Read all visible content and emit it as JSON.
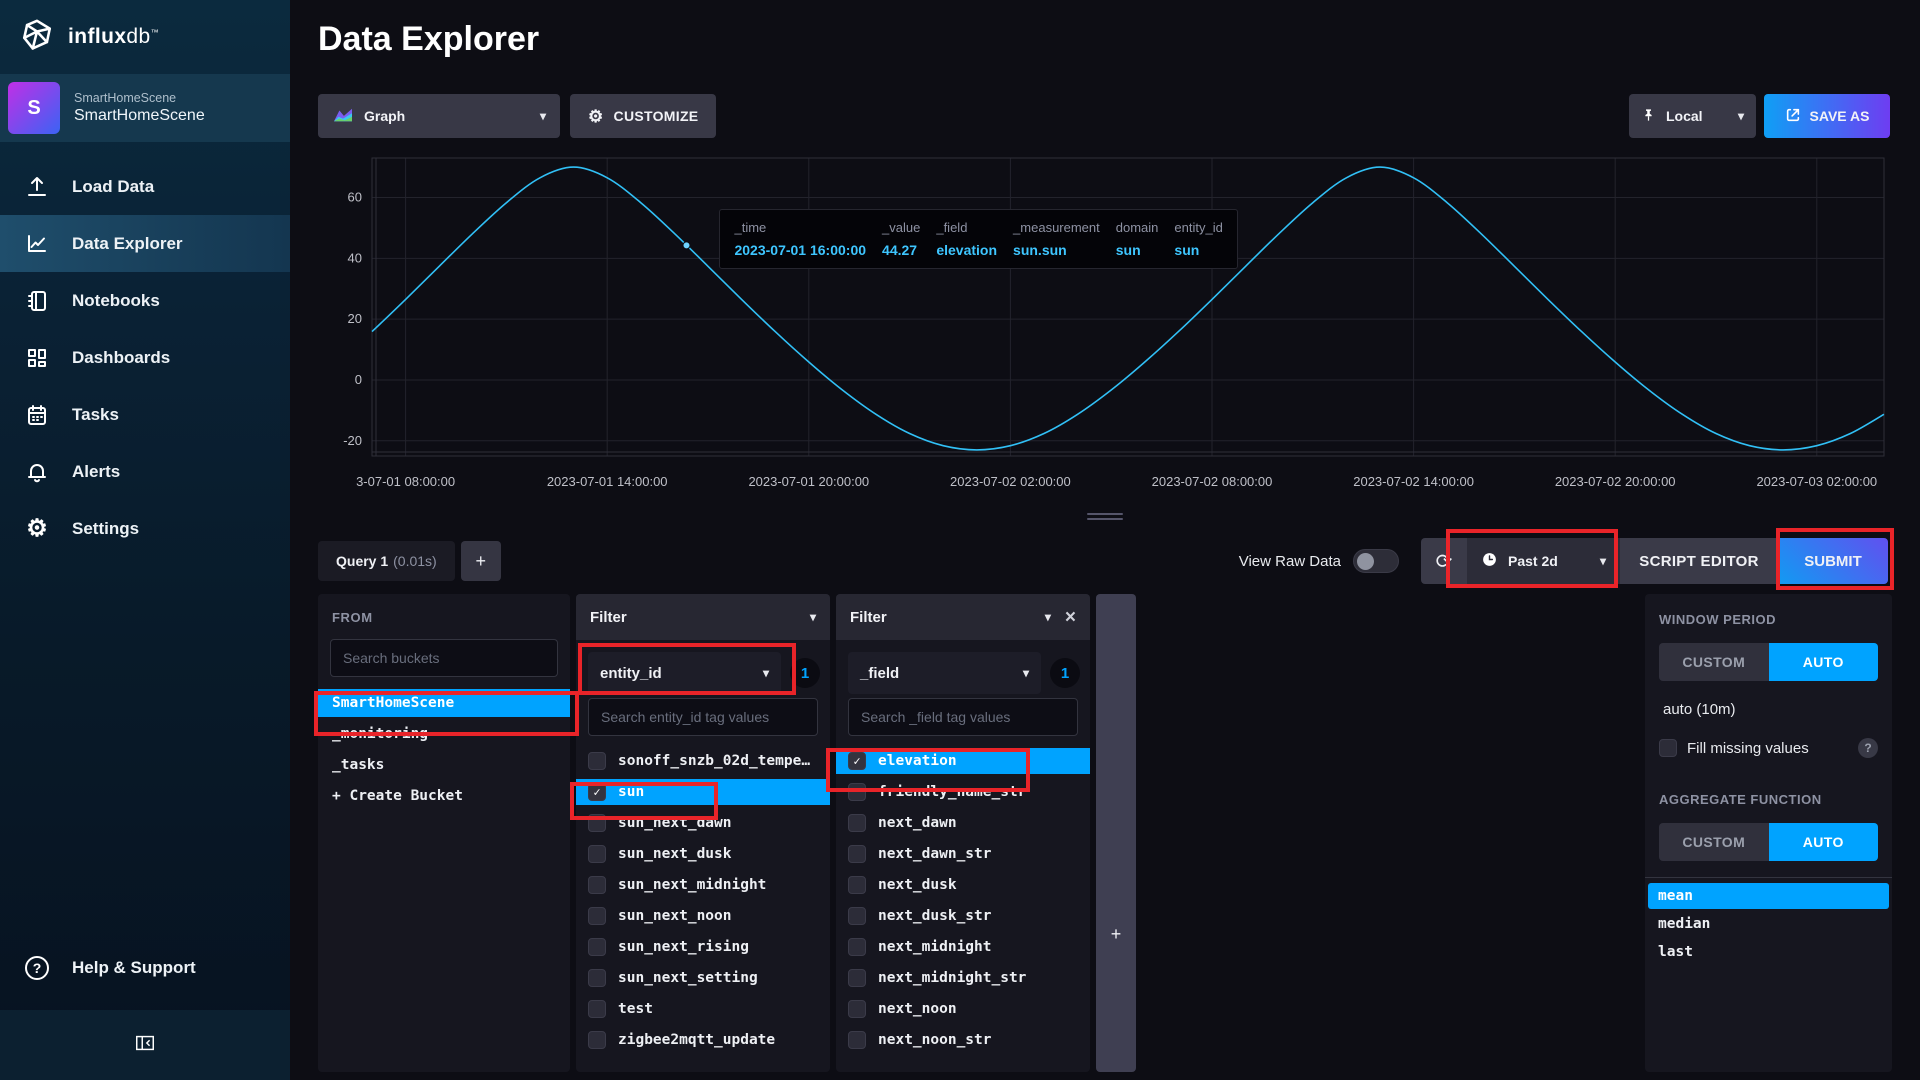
{
  "colors": {
    "accent": "#00a3ff",
    "line": "#31c0f6",
    "annotation": "#e92429",
    "save_gradient": [
      "#0f9ff5",
      "#6e3df2"
    ]
  },
  "sidebar": {
    "logo_bold": "influx",
    "logo_light": "db",
    "logo_tm": "™",
    "org": {
      "avatar_letter": "S",
      "line1": "SmartHomeScene",
      "line2": "SmartHomeScene"
    },
    "nav": [
      {
        "icon": "upload-icon",
        "label": "Load Data"
      },
      {
        "icon": "line-chart-icon",
        "label": "Data Explorer",
        "active": true
      },
      {
        "icon": "notebook-icon",
        "label": "Notebooks"
      },
      {
        "icon": "grid-icon",
        "label": "Dashboards"
      },
      {
        "icon": "calendar-icon",
        "label": "Tasks"
      },
      {
        "icon": "bell-icon",
        "label": "Alerts"
      },
      {
        "icon": "gear-icon",
        "label": "Settings"
      }
    ],
    "help_label": "Help & Support"
  },
  "header": {
    "title": "Data Explorer",
    "graph_dropdown_label": "Graph",
    "customize_label": "CUSTOMIZE",
    "local_label": "Local",
    "save_as_label": "SAVE AS"
  },
  "chart_data": {
    "type": "line",
    "series_name": "elevation (sun.sun)",
    "x_unit": "hours since 2023-07-01 00:00",
    "xlim": [
      7,
      52
    ],
    "ylim": [
      -25,
      73
    ],
    "y_ticks": [
      60,
      40,
      20,
      0,
      -20
    ],
    "x_ticks": [
      {
        "t": 8,
        "label": "3-07-01 08:00:00"
      },
      {
        "t": 14,
        "label": "2023-07-01 14:00:00"
      },
      {
        "t": 20,
        "label": "2023-07-01 20:00:00"
      },
      {
        "t": 26,
        "label": "2023-07-02 02:00:00"
      },
      {
        "t": 32,
        "label": "2023-07-02 08:00:00"
      },
      {
        "t": 38,
        "label": "2023-07-02 14:00:00"
      },
      {
        "t": 44,
        "label": "2023-07-02 20:00:00"
      },
      {
        "t": 50,
        "label": "2023-07-03 02:00:00"
      }
    ],
    "samples": [
      [
        7,
        15.9
      ],
      [
        8,
        26.5
      ],
      [
        9,
        37.4
      ],
      [
        10,
        48.2
      ],
      [
        11,
        58.3
      ],
      [
        12,
        66.5
      ],
      [
        13,
        70.0
      ],
      [
        14,
        66.5
      ],
      [
        15,
        58.3
      ],
      [
        16,
        48.2
      ],
      [
        17,
        37.4
      ],
      [
        18,
        26.5
      ],
      [
        19,
        15.9
      ],
      [
        20,
        5.9
      ],
      [
        21,
        -3.3
      ],
      [
        22,
        -11.3
      ],
      [
        23,
        -17.6
      ],
      [
        24,
        -21.6
      ],
      [
        25,
        -23.0
      ],
      [
        26,
        -21.6
      ],
      [
        27,
        -17.6
      ],
      [
        28,
        -11.3
      ],
      [
        29,
        -3.3
      ],
      [
        30,
        5.9
      ],
      [
        31,
        15.9
      ],
      [
        32,
        26.5
      ],
      [
        33,
        37.4
      ],
      [
        34,
        48.2
      ],
      [
        35,
        58.3
      ],
      [
        36,
        66.5
      ],
      [
        37,
        70.0
      ],
      [
        38,
        66.5
      ],
      [
        39,
        58.3
      ],
      [
        40,
        48.2
      ],
      [
        41,
        37.4
      ],
      [
        42,
        26.5
      ],
      [
        43,
        15.9
      ],
      [
        44,
        5.9
      ],
      [
        45,
        -3.3
      ],
      [
        46,
        -11.3
      ],
      [
        47,
        -17.6
      ],
      [
        48,
        -21.6
      ],
      [
        49,
        -23.0
      ],
      [
        50,
        -21.6
      ],
      [
        51,
        -17.6
      ],
      [
        52,
        -11.3
      ]
    ],
    "marker": {
      "t": 16.36,
      "value": 44.27
    },
    "grid": true,
    "legend": false
  },
  "tooltip": {
    "columns": [
      {
        "label": "_time",
        "value": "2023-07-01 16:00:00"
      },
      {
        "label": "_value",
        "value": "44.27"
      },
      {
        "label": "_field",
        "value": "elevation"
      },
      {
        "label": "_measurement",
        "value": "sun.sun"
      },
      {
        "label": "domain",
        "value": "sun"
      },
      {
        "label": "entity_id",
        "value": "sun"
      }
    ]
  },
  "query_bar": {
    "tab_label": "Query 1",
    "tab_time": "(0.01s)",
    "add_label": "+",
    "view_raw_label": "View Raw Data",
    "time_range_label": "Past 2d",
    "script_editor_label": "SCRIPT EDITOR",
    "submit_label": "SUBMIT"
  },
  "from_panel": {
    "title": "FROM",
    "search_placeholder": "Search buckets",
    "buckets": [
      {
        "name": "SmartHomeScene",
        "selected": true
      },
      {
        "name": "_monitoring"
      },
      {
        "name": "_tasks"
      },
      {
        "name": "+ Create Bucket"
      }
    ]
  },
  "filter1": {
    "title": "Filter",
    "tag_key": "entity_id",
    "badge": "1",
    "search_placeholder": "Search entity_id tag values",
    "values": [
      {
        "name": "sonoff_snzb_02d_tempe…"
      },
      {
        "name": "sun",
        "checked": true,
        "selected": true
      },
      {
        "name": "sun_next_dawn"
      },
      {
        "name": "sun_next_dusk"
      },
      {
        "name": "sun_next_midnight"
      },
      {
        "name": "sun_next_noon"
      },
      {
        "name": "sun_next_rising"
      },
      {
        "name": "sun_next_setting"
      },
      {
        "name": "test"
      },
      {
        "name": "zigbee2mqtt_update"
      }
    ]
  },
  "filter2": {
    "title": "Filter",
    "tag_key": "_field",
    "badge": "1",
    "search_placeholder": "Search _field tag values",
    "values": [
      {
        "name": "elevation",
        "checked": true,
        "selected": true
      },
      {
        "name": "friendly_name_str"
      },
      {
        "name": "next_dawn"
      },
      {
        "name": "next_dawn_str"
      },
      {
        "name": "next_dusk"
      },
      {
        "name": "next_dusk_str"
      },
      {
        "name": "next_midnight"
      },
      {
        "name": "next_midnight_str"
      },
      {
        "name": "next_noon"
      },
      {
        "name": "next_noon_str"
      }
    ]
  },
  "add_column_label": "+",
  "right_panel": {
    "window_period_label": "WINDOW PERIOD",
    "custom_label": "CUSTOM",
    "auto_label": "AUTO",
    "auto_value": "auto (10m)",
    "fill_label": "Fill missing values",
    "help_glyph": "?",
    "aggregate_label": "AGGREGATE FUNCTION",
    "functions": [
      {
        "name": "mean",
        "selected": true
      },
      {
        "name": "median"
      },
      {
        "name": "last"
      }
    ]
  }
}
